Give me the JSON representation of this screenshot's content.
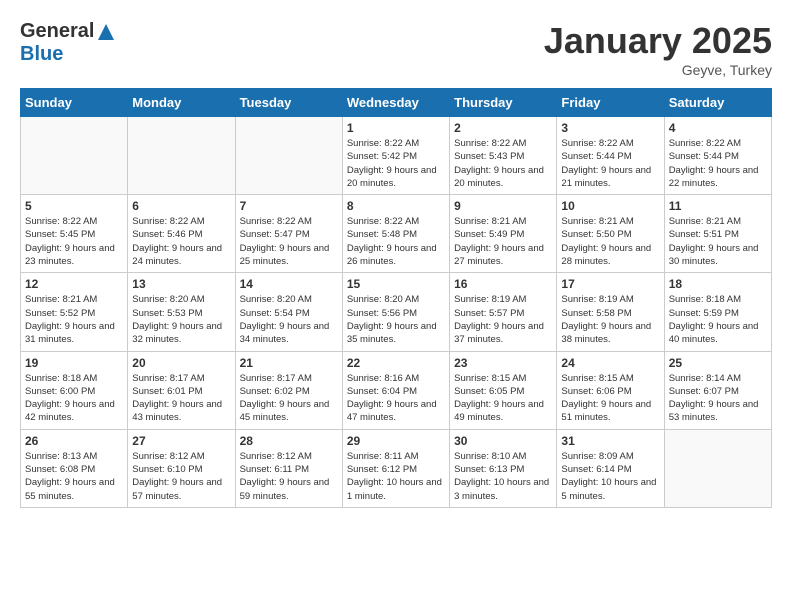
{
  "header": {
    "logo_general": "General",
    "logo_blue": "Blue",
    "month_title": "January 2025",
    "location": "Geyve, Turkey"
  },
  "days_of_week": [
    "Sunday",
    "Monday",
    "Tuesday",
    "Wednesday",
    "Thursday",
    "Friday",
    "Saturday"
  ],
  "weeks": [
    [
      {
        "day": "",
        "content": ""
      },
      {
        "day": "",
        "content": ""
      },
      {
        "day": "",
        "content": ""
      },
      {
        "day": "1",
        "content": "Sunrise: 8:22 AM\nSunset: 5:42 PM\nDaylight: 9 hours\nand 20 minutes."
      },
      {
        "day": "2",
        "content": "Sunrise: 8:22 AM\nSunset: 5:43 PM\nDaylight: 9 hours\nand 20 minutes."
      },
      {
        "day": "3",
        "content": "Sunrise: 8:22 AM\nSunset: 5:44 PM\nDaylight: 9 hours\nand 21 minutes."
      },
      {
        "day": "4",
        "content": "Sunrise: 8:22 AM\nSunset: 5:44 PM\nDaylight: 9 hours\nand 22 minutes."
      }
    ],
    [
      {
        "day": "5",
        "content": "Sunrise: 8:22 AM\nSunset: 5:45 PM\nDaylight: 9 hours\nand 23 minutes."
      },
      {
        "day": "6",
        "content": "Sunrise: 8:22 AM\nSunset: 5:46 PM\nDaylight: 9 hours\nand 24 minutes."
      },
      {
        "day": "7",
        "content": "Sunrise: 8:22 AM\nSunset: 5:47 PM\nDaylight: 9 hours\nand 25 minutes."
      },
      {
        "day": "8",
        "content": "Sunrise: 8:22 AM\nSunset: 5:48 PM\nDaylight: 9 hours\nand 26 minutes."
      },
      {
        "day": "9",
        "content": "Sunrise: 8:21 AM\nSunset: 5:49 PM\nDaylight: 9 hours\nand 27 minutes."
      },
      {
        "day": "10",
        "content": "Sunrise: 8:21 AM\nSunset: 5:50 PM\nDaylight: 9 hours\nand 28 minutes."
      },
      {
        "day": "11",
        "content": "Sunrise: 8:21 AM\nSunset: 5:51 PM\nDaylight: 9 hours\nand 30 minutes."
      }
    ],
    [
      {
        "day": "12",
        "content": "Sunrise: 8:21 AM\nSunset: 5:52 PM\nDaylight: 9 hours\nand 31 minutes."
      },
      {
        "day": "13",
        "content": "Sunrise: 8:20 AM\nSunset: 5:53 PM\nDaylight: 9 hours\nand 32 minutes."
      },
      {
        "day": "14",
        "content": "Sunrise: 8:20 AM\nSunset: 5:54 PM\nDaylight: 9 hours\nand 34 minutes."
      },
      {
        "day": "15",
        "content": "Sunrise: 8:20 AM\nSunset: 5:56 PM\nDaylight: 9 hours\nand 35 minutes."
      },
      {
        "day": "16",
        "content": "Sunrise: 8:19 AM\nSunset: 5:57 PM\nDaylight: 9 hours\nand 37 minutes."
      },
      {
        "day": "17",
        "content": "Sunrise: 8:19 AM\nSunset: 5:58 PM\nDaylight: 9 hours\nand 38 minutes."
      },
      {
        "day": "18",
        "content": "Sunrise: 8:18 AM\nSunset: 5:59 PM\nDaylight: 9 hours\nand 40 minutes."
      }
    ],
    [
      {
        "day": "19",
        "content": "Sunrise: 8:18 AM\nSunset: 6:00 PM\nDaylight: 9 hours\nand 42 minutes."
      },
      {
        "day": "20",
        "content": "Sunrise: 8:17 AM\nSunset: 6:01 PM\nDaylight: 9 hours\nand 43 minutes."
      },
      {
        "day": "21",
        "content": "Sunrise: 8:17 AM\nSunset: 6:02 PM\nDaylight: 9 hours\nand 45 minutes."
      },
      {
        "day": "22",
        "content": "Sunrise: 8:16 AM\nSunset: 6:04 PM\nDaylight: 9 hours\nand 47 minutes."
      },
      {
        "day": "23",
        "content": "Sunrise: 8:15 AM\nSunset: 6:05 PM\nDaylight: 9 hours\nand 49 minutes."
      },
      {
        "day": "24",
        "content": "Sunrise: 8:15 AM\nSunset: 6:06 PM\nDaylight: 9 hours\nand 51 minutes."
      },
      {
        "day": "25",
        "content": "Sunrise: 8:14 AM\nSunset: 6:07 PM\nDaylight: 9 hours\nand 53 minutes."
      }
    ],
    [
      {
        "day": "26",
        "content": "Sunrise: 8:13 AM\nSunset: 6:08 PM\nDaylight: 9 hours\nand 55 minutes."
      },
      {
        "day": "27",
        "content": "Sunrise: 8:12 AM\nSunset: 6:10 PM\nDaylight: 9 hours\nand 57 minutes."
      },
      {
        "day": "28",
        "content": "Sunrise: 8:12 AM\nSunset: 6:11 PM\nDaylight: 9 hours\nand 59 minutes."
      },
      {
        "day": "29",
        "content": "Sunrise: 8:11 AM\nSunset: 6:12 PM\nDaylight: 10 hours\nand 1 minute."
      },
      {
        "day": "30",
        "content": "Sunrise: 8:10 AM\nSunset: 6:13 PM\nDaylight: 10 hours\nand 3 minutes."
      },
      {
        "day": "31",
        "content": "Sunrise: 8:09 AM\nSunset: 6:14 PM\nDaylight: 10 hours\nand 5 minutes."
      },
      {
        "day": "",
        "content": ""
      }
    ]
  ]
}
